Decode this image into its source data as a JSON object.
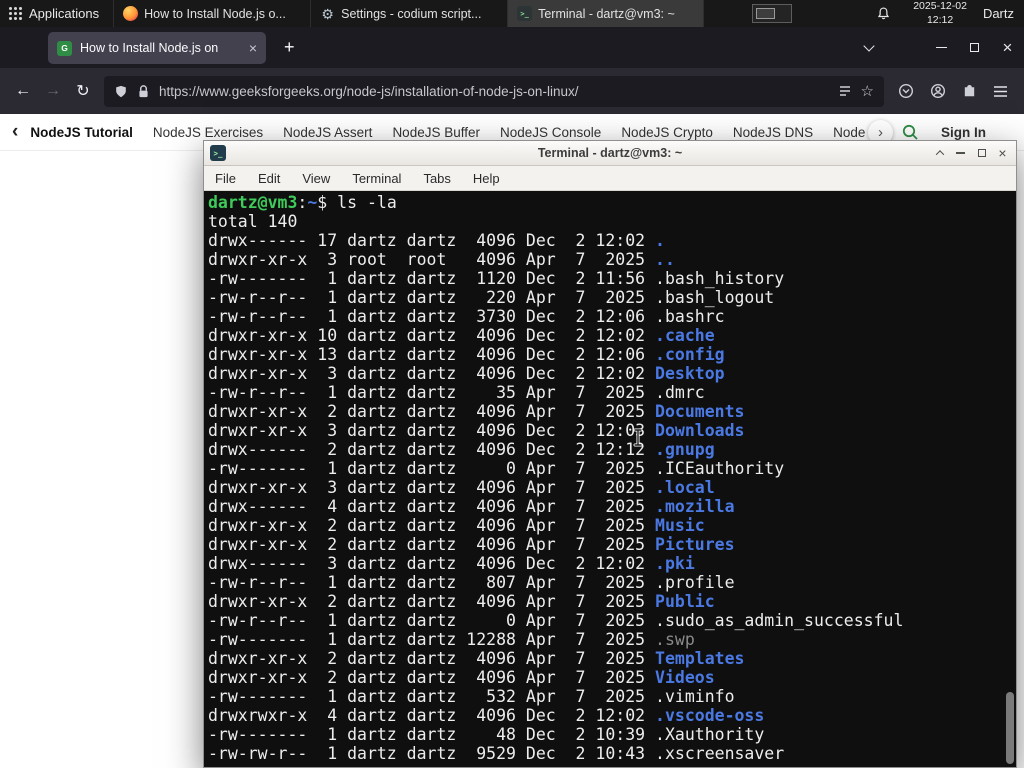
{
  "panel": {
    "applications_label": "Applications",
    "windows": [
      {
        "title": "How to Install Node.js o...",
        "icon": "firefox",
        "active": false
      },
      {
        "title": "Settings - codium script...",
        "icon": "settings",
        "active": false
      },
      {
        "title": "Terminal - dartz@vm3: ~",
        "icon": "terminal",
        "active": true
      }
    ],
    "clock": {
      "date": "2025-12-02",
      "time": "12:12"
    },
    "user": "Dartz"
  },
  "browser": {
    "tab_title": "How to Install Node.js on",
    "url": "https://www.geeksforgeeks.org/node-js/installation-of-node-js-on-linux/",
    "site_nav": {
      "back_chevron": "‹",
      "forward_chevron": "›",
      "items": [
        "NodeJS Tutorial",
        "NodeJS Exercises",
        "NodeJS Assert",
        "NodeJS Buffer",
        "NodeJS Console",
        "NodeJS Crypto",
        "NodeJS DNS",
        "Node"
      ],
      "sign_in_label": "Sign In"
    }
  },
  "terminal": {
    "window_title": "Terminal - dartz@vm3: ~",
    "menu_items": [
      "File",
      "Edit",
      "View",
      "Terminal",
      "Tabs",
      "Help"
    ],
    "prompt": {
      "user_host": "dartz@vm3",
      "separator": ":",
      "path": "~",
      "symbol": "$",
      "command": "ls -la"
    },
    "total_line": "total 140",
    "listing": [
      {
        "pre": "drwx------ 17 dartz dartz  4096 Dec  2 12:02 ",
        "name": ".",
        "type": "dir"
      },
      {
        "pre": "drwxr-xr-x  3 root  root   4096 Apr  7  2025 ",
        "name": "..",
        "type": "dir"
      },
      {
        "pre": "-rw-------  1 dartz dartz  1120 Dec  2 11:56 ",
        "name": ".bash_history",
        "type": "file"
      },
      {
        "pre": "-rw-r--r--  1 dartz dartz   220 Apr  7  2025 ",
        "name": ".bash_logout",
        "type": "file"
      },
      {
        "pre": "-rw-r--r--  1 dartz dartz  3730 Dec  2 12:06 ",
        "name": ".bashrc",
        "type": "file"
      },
      {
        "pre": "drwxr-xr-x 10 dartz dartz  4096 Dec  2 12:02 ",
        "name": ".cache",
        "type": "dir"
      },
      {
        "pre": "drwxr-xr-x 13 dartz dartz  4096 Dec  2 12:06 ",
        "name": ".config",
        "type": "dir"
      },
      {
        "pre": "drwxr-xr-x  3 dartz dartz  4096 Dec  2 12:02 ",
        "name": "Desktop",
        "type": "dir"
      },
      {
        "pre": "-rw-r--r--  1 dartz dartz    35 Apr  7  2025 ",
        "name": ".dmrc",
        "type": "file"
      },
      {
        "pre": "drwxr-xr-x  2 dartz dartz  4096 Apr  7  2025 ",
        "name": "Documents",
        "type": "dir"
      },
      {
        "pre": "drwxr-xr-x  3 dartz dartz  4096 Dec  2 12:03 ",
        "name": "Downloads",
        "type": "dir"
      },
      {
        "pre": "drwx------  2 dartz dartz  4096 Dec  2 12:12 ",
        "name": ".gnupg",
        "type": "dir"
      },
      {
        "pre": "-rw-------  1 dartz dartz     0 Apr  7  2025 ",
        "name": ".ICEauthority",
        "type": "file"
      },
      {
        "pre": "drwxr-xr-x  3 dartz dartz  4096 Apr  7  2025 ",
        "name": ".local",
        "type": "dir"
      },
      {
        "pre": "drwx------  4 dartz dartz  4096 Apr  7  2025 ",
        "name": ".mozilla",
        "type": "dir"
      },
      {
        "pre": "drwxr-xr-x  2 dartz dartz  4096 Apr  7  2025 ",
        "name": "Music",
        "type": "dir"
      },
      {
        "pre": "drwxr-xr-x  2 dartz dartz  4096 Apr  7  2025 ",
        "name": "Pictures",
        "type": "dir"
      },
      {
        "pre": "drwx------  3 dartz dartz  4096 Dec  2 12:02 ",
        "name": ".pki",
        "type": "dir"
      },
      {
        "pre": "-rw-r--r--  1 dartz dartz   807 Apr  7  2025 ",
        "name": ".profile",
        "type": "file"
      },
      {
        "pre": "drwxr-xr-x  2 dartz dartz  4096 Apr  7  2025 ",
        "name": "Public",
        "type": "dir"
      },
      {
        "pre": "-rw-r--r--  1 dartz dartz     0 Apr  7  2025 ",
        "name": ".sudo_as_admin_successful",
        "type": "file"
      },
      {
        "pre": "-rw-------  1 dartz dartz 12288 Apr  7  2025 ",
        "name": ".swp",
        "type": "dim"
      },
      {
        "pre": "drwxr-xr-x  2 dartz dartz  4096 Apr  7  2025 ",
        "name": "Templates",
        "type": "dir"
      },
      {
        "pre": "drwxr-xr-x  2 dartz dartz  4096 Apr  7  2025 ",
        "name": "Videos",
        "type": "dir"
      },
      {
        "pre": "-rw-------  1 dartz dartz   532 Apr  7  2025 ",
        "name": ".viminfo",
        "type": "file"
      },
      {
        "pre": "drwxrwxr-x  4 dartz dartz  4096 Dec  2 12:02 ",
        "name": ".vscode-oss",
        "type": "dir"
      },
      {
        "pre": "-rw-------  1 dartz dartz    48 Dec  2 10:39 ",
        "name": ".Xauthority",
        "type": "file"
      },
      {
        "pre": "-rw-rw-r--  1 dartz dartz  9529 Dec  2 10:43 ",
        "name": ".xscreensaver",
        "type": "file"
      }
    ]
  },
  "colors": {
    "gfg_green": "#2f8d46",
    "terminal_prompt_green": "#3ecb5a",
    "terminal_dir_blue": "#4b79e4",
    "terminal_dim_gray": "#8a8a8a"
  }
}
